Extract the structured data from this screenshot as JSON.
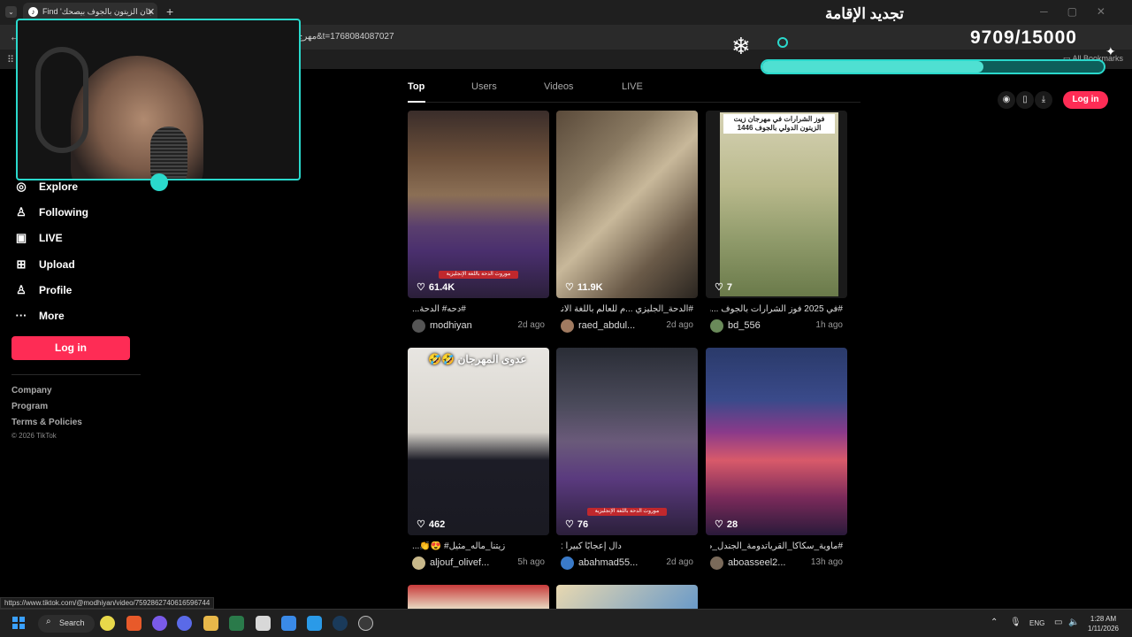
{
  "browser": {
    "tab_title": "Find 'جان الزيتون بالجوف بيصحك",
    "tab_icon": "tiktok-icon",
    "url": "مهرج&t=1768084087027",
    "all_bookmarks": "All Bookmarks"
  },
  "overlay": {
    "title": "تجديد الإقامة",
    "counter": "9709/15000",
    "progress": 0.647,
    "accent": "#2ad9cc"
  },
  "sidebar": {
    "items": [
      {
        "label": "Explore",
        "icon": "compass-icon"
      },
      {
        "label": "Following",
        "icon": "following-icon"
      },
      {
        "label": "LIVE",
        "icon": "live-icon"
      },
      {
        "label": "Upload",
        "icon": "upload-icon"
      },
      {
        "label": "Profile",
        "icon": "profile-icon"
      },
      {
        "label": "More",
        "icon": "more-icon"
      }
    ],
    "login": "Log in",
    "footer": [
      "Company",
      "Program",
      "Terms & Policies"
    ],
    "copyright": "© 2026 TikTok"
  },
  "tabs": [
    {
      "label": "Top",
      "active": true
    },
    {
      "label": "Users",
      "active": false
    },
    {
      "label": "Videos",
      "active": false
    },
    {
      "label": "LIVE",
      "active": false
    }
  ],
  "header": {
    "login": "Log in",
    "brand_color": "#fe2c55"
  },
  "videos": [
    {
      "likes": "61.4K",
      "caption": "#دحه# الدحة...",
      "author": "modhiyan",
      "age": "2d ago",
      "tag": "موروث الدحة باللغة الإنجليزية"
    },
    {
      "likes": "11.9K",
      "caption": "#الدحة_الجليزي ...م للعالم باللغة الانجليزية",
      "author": "raed_abdul...",
      "age": "2d ago",
      "tag": ""
    },
    {
      "likes": "7",
      "caption": "#في 2025 فوز الشرارات بالجوف ...ون",
      "author": "bd_556",
      "age": "1h ago",
      "tag": ""
    },
    {
      "likes": "462",
      "caption": "زيتنا_ماله_مثيل# 😍👏...",
      "author": "aljouf_olivef...",
      "age": "5h ago",
      "tag": ""
    },
    {
      "likes": "76",
      "caption": "دال إعجابًا كبيراً :",
      "author": "abahmad55...",
      "age": "2d ago",
      "tag": "موروث الدحة باللغة الإنجليزية"
    },
    {
      "likes": "28",
      "caption": "#ماوية_سكاكا_القرياتدومة_الجندل_طبرجل",
      "author": "aboasseel2...",
      "age": "13h ago",
      "tag": ""
    }
  ],
  "overlay_texts": {
    "card3_title": "فوز الشرارات في مهرجان زيت الزيتون الدولي بالجوف 1446",
    "card4_title": "عدوى المهرجان 🤣🤣"
  },
  "status_url": "https://www.tiktok.com/@modhiyan/video/7592862740616596744",
  "taskbar": {
    "search": "Search",
    "lang": "ENG",
    "time": "1:28 AM",
    "date": "1/11/2026"
  }
}
